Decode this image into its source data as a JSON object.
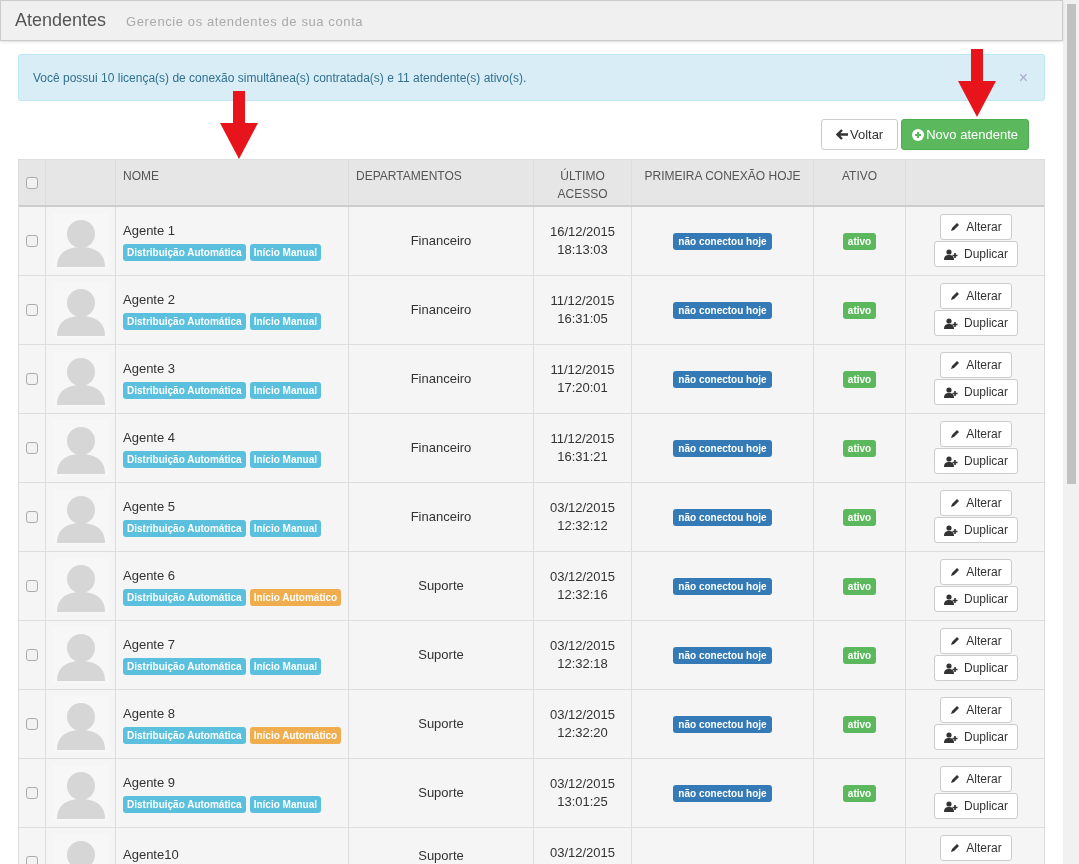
{
  "header": {
    "title": "Atendentes",
    "subtitle": "Gerencie os atendentes de sua conta"
  },
  "alert": {
    "text": "Você possui 10 licença(s) de conexão simultânea(s) contratada(s) e 11 atendente(s) ativo(s).",
    "close": "×"
  },
  "actions": [
    {
      "label": "Voltar",
      "kind": "back"
    },
    {
      "label": "Novo atendente",
      "kind": "new"
    }
  ],
  "table": {
    "select_all": {
      "checked": false
    },
    "columns": [
      "NOME",
      "DEPARTAMENTOS",
      "ÚLTIMO ACESSO",
      "PRIMEIRA CONEXÃO HOJE",
      "ATIVO"
    ],
    "rows": [
      {
        "checked": false,
        "name": "Agente 1",
        "tags": [
          {
            "label": "Distribuição Automática",
            "color": "#5bc0de"
          },
          {
            "label": "Início Manual",
            "color": "#5bc0de"
          }
        ],
        "department": "Financeiro",
        "date": "16/12/2015",
        "time": "18:13:03",
        "connection": "não conectou hoje",
        "status": "ativo",
        "edit": "Alterar",
        "duplicate": "Duplicar"
      },
      {
        "checked": false,
        "name": "Agente 2",
        "tags": [
          {
            "label": "Distribuição Automática",
            "color": "#5bc0de"
          },
          {
            "label": "Início Manual",
            "color": "#5bc0de"
          }
        ],
        "department": "Financeiro",
        "date": "11/12/2015",
        "time": "16:31:05",
        "connection": "não conectou hoje",
        "status": "ativo",
        "edit": "Alterar",
        "duplicate": "Duplicar"
      },
      {
        "checked": false,
        "name": "Agente 3",
        "tags": [
          {
            "label": "Distribuição Automática",
            "color": "#5bc0de"
          },
          {
            "label": "Início Manual",
            "color": "#5bc0de"
          }
        ],
        "department": "Financeiro",
        "date": "11/12/2015",
        "time": "17:20:01",
        "connection": "não conectou hoje",
        "status": "ativo",
        "edit": "Alterar",
        "duplicate": "Duplicar"
      },
      {
        "checked": false,
        "name": "Agente 4",
        "tags": [
          {
            "label": "Distribuição Automática",
            "color": "#5bc0de"
          },
          {
            "label": "Início Manual",
            "color": "#5bc0de"
          }
        ],
        "department": "Financeiro",
        "date": "11/12/2015",
        "time": "16:31:21",
        "connection": "não conectou hoje",
        "status": "ativo",
        "edit": "Alterar",
        "duplicate": "Duplicar"
      },
      {
        "checked": false,
        "name": "Agente 5",
        "tags": [
          {
            "label": "Distribuição Automática",
            "color": "#5bc0de"
          },
          {
            "label": "Início Manual",
            "color": "#5bc0de"
          }
        ],
        "department": "Financeiro",
        "date": "03/12/2015",
        "time": "12:32:12",
        "connection": "não conectou hoje",
        "status": "ativo",
        "edit": "Alterar",
        "duplicate": "Duplicar"
      },
      {
        "checked": false,
        "name": "Agente 6",
        "tags": [
          {
            "label": "Distribuição Automática",
            "color": "#5bc0de"
          },
          {
            "label": "Início Automático",
            "color": "#f0ad4e"
          }
        ],
        "department": "Suporte",
        "date": "03/12/2015",
        "time": "12:32:16",
        "connection": "não conectou hoje",
        "status": "ativo",
        "edit": "Alterar",
        "duplicate": "Duplicar"
      },
      {
        "checked": false,
        "name": "Agente 7",
        "tags": [
          {
            "label": "Distribuição Automática",
            "color": "#5bc0de"
          },
          {
            "label": "Início Manual",
            "color": "#5bc0de"
          }
        ],
        "department": "Suporte",
        "date": "03/12/2015",
        "time": "12:32:18",
        "connection": "não conectou hoje",
        "status": "ativo",
        "edit": "Alterar",
        "duplicate": "Duplicar"
      },
      {
        "checked": false,
        "name": "Agente 8",
        "tags": [
          {
            "label": "Distribuição Automática",
            "color": "#5bc0de"
          },
          {
            "label": "Início Automático",
            "color": "#f0ad4e"
          }
        ],
        "department": "Suporte",
        "date": "03/12/2015",
        "time": "12:32:20",
        "connection": "não conectou hoje",
        "status": "ativo",
        "edit": "Alterar",
        "duplicate": "Duplicar"
      },
      {
        "checked": false,
        "name": "Agente 9",
        "tags": [
          {
            "label": "Distribuição Automática",
            "color": "#5bc0de"
          },
          {
            "label": "Início Manual",
            "color": "#5bc0de"
          }
        ],
        "department": "Suporte",
        "date": "03/12/2015",
        "time": "13:01:25",
        "connection": "não conectou hoje",
        "status": "ativo",
        "edit": "Alterar",
        "duplicate": "Duplicar"
      },
      {
        "checked": false,
        "name": "Agente10",
        "department": "Suporte",
        "date": "03/12/2015",
        "edit": "Alterar"
      }
    ]
  }
}
